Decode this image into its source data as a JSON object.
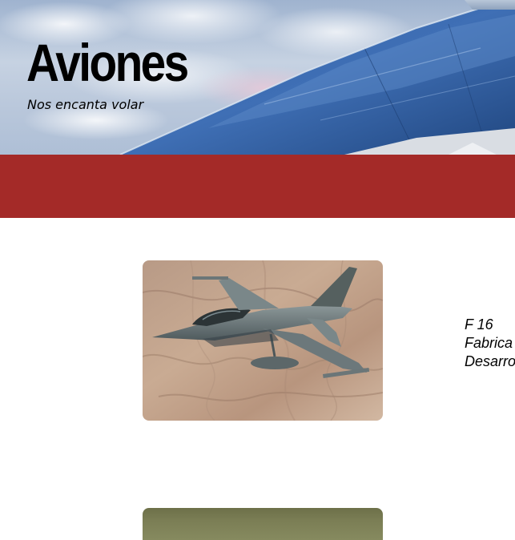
{
  "header": {
    "title": "Aviones",
    "subtitle": "Nos encanta volar"
  },
  "colors": {
    "band": "#a42a28",
    "title": "#000000"
  },
  "planes": [
    {
      "image": "f16-jet-over-desert",
      "name": "F 16",
      "info_line_2": "Fabrica",
      "info_line_3": "Desarro"
    },
    {
      "image": "aircraft-on-grass"
    }
  ]
}
